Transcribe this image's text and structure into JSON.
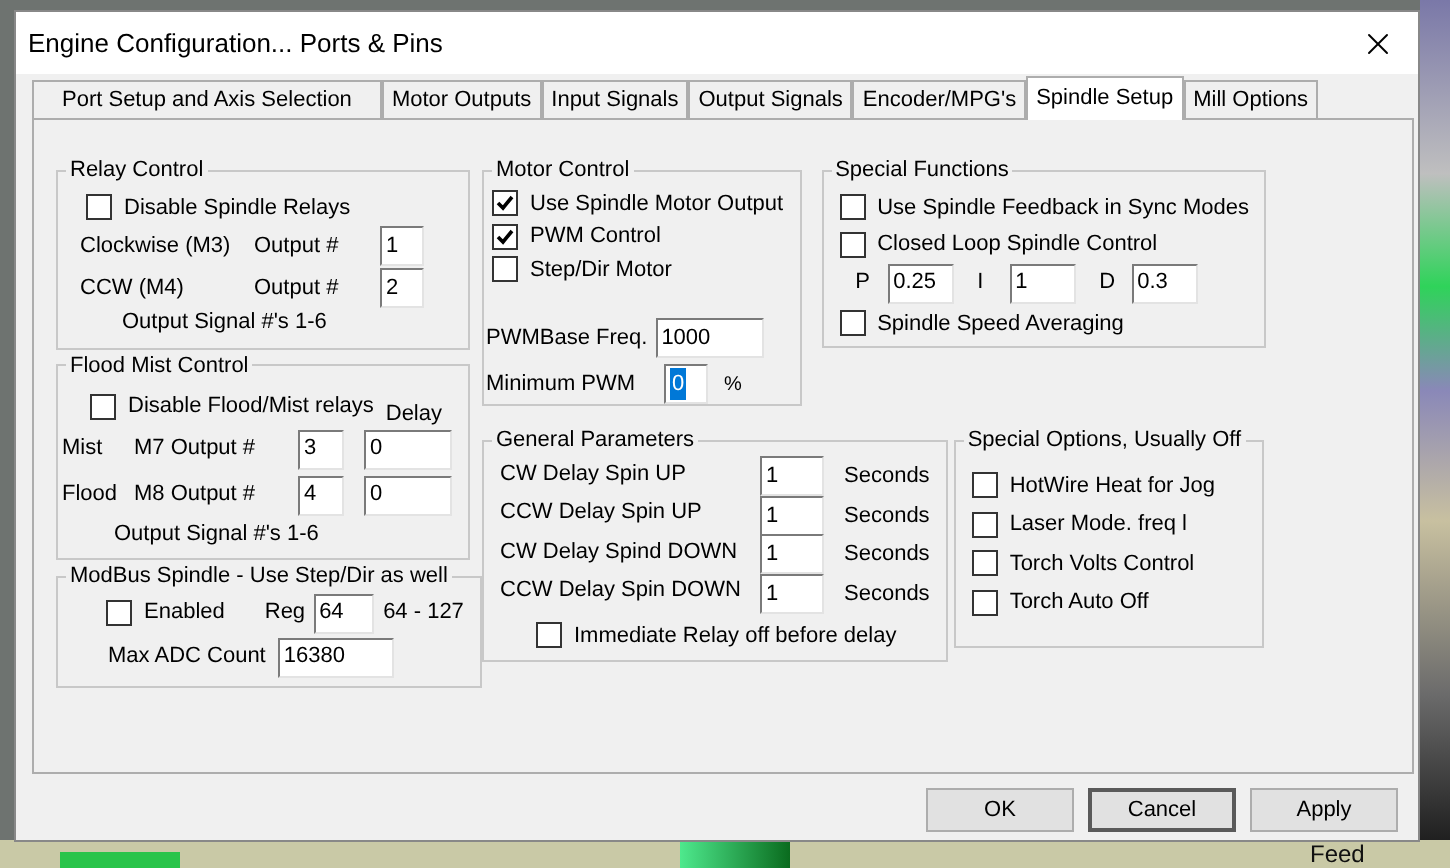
{
  "window": {
    "title": "Engine Configuration... Ports & Pins"
  },
  "tabs": [
    {
      "label": "Port Setup and Axis Selection",
      "selected": false
    },
    {
      "label": "Motor Outputs",
      "selected": false
    },
    {
      "label": "Input Signals",
      "selected": false
    },
    {
      "label": "Output Signals",
      "selected": false
    },
    {
      "label": "Encoder/MPG's",
      "selected": false
    },
    {
      "label": "Spindle Setup",
      "selected": true
    },
    {
      "label": "Mill Options",
      "selected": false
    }
  ],
  "relay_control": {
    "title": "Relay Control",
    "checkbox": {
      "label": "Disable Spindle Relays",
      "checked": false
    },
    "rows": [
      {
        "label": "Clockwise (M3)",
        "output_label": "Output #",
        "value": "1"
      },
      {
        "label": "CCW (M4)",
        "output_label": "Output #",
        "value": "2"
      }
    ],
    "note": "Output Signal #'s 1-6"
  },
  "flood_mist_control": {
    "title": "Flood Mist Control",
    "checkbox": {
      "label": "Disable Flood/Mist relays",
      "checked": false
    },
    "delay_label": "Delay",
    "rows": [
      {
        "label": "Mist",
        "output_label": "M7 Output #",
        "value": "3",
        "delay": "0"
      },
      {
        "label": "Flood",
        "output_label": "M8 Output #",
        "value": "4",
        "delay": "0"
      }
    ],
    "note": "Output Signal #'s 1-6"
  },
  "modbus_spindle": {
    "title": "ModBus Spindle - Use Step/Dir as well",
    "checkbox": {
      "label": "Enabled",
      "checked": false
    },
    "reg_label": "Reg",
    "reg_value": "64",
    "reg_range": "64 - 127",
    "max_adc_label": "Max ADC Count",
    "max_adc_value": "16380"
  },
  "motor_control": {
    "title": "Motor Control",
    "checkboxes": [
      {
        "label": "Use Spindle Motor Output",
        "checked": true
      },
      {
        "label": "PWM Control",
        "checked": true
      },
      {
        "label": "Step/Dir Motor",
        "checked": false
      }
    ],
    "pwm_base_label": "PWMBase Freq.",
    "pwm_base_value": "1000",
    "min_pwm_label": "Minimum PWM",
    "min_pwm_value": "0",
    "min_pwm_highlighted": true,
    "min_pwm_unit": "%"
  },
  "special_functions": {
    "title": "Special Functions",
    "checkboxes": [
      {
        "label": "Use Spindle Feedback in Sync Modes",
        "checked": false
      },
      {
        "label": "Closed Loop Spindle Control",
        "checked": false
      }
    ],
    "pid": [
      {
        "label": "P",
        "value": "0.25"
      },
      {
        "label": "I",
        "value": "1"
      },
      {
        "label": "D",
        "value": "0.3"
      }
    ],
    "last_checkbox": {
      "label": "Spindle Speed Averaging",
      "checked": false
    }
  },
  "general_parameters": {
    "title": "General Parameters",
    "rows": [
      {
        "label": "CW Delay Spin UP",
        "value": "1",
        "unit": "Seconds"
      },
      {
        "label": "CCW Delay Spin UP",
        "value": "1",
        "unit": "Seconds"
      },
      {
        "label": "CW Delay Spind DOWN",
        "value": "1",
        "unit": "Seconds"
      },
      {
        "label": "CCW Delay Spin DOWN",
        "value": "1",
        "unit": "Seconds"
      }
    ],
    "checkbox": {
      "label": "Immediate Relay off before delay",
      "checked": false
    }
  },
  "special_options": {
    "title": "Special Options, Usually Off",
    "checkboxes": [
      {
        "label": "HotWire Heat for Jog",
        "checked": false
      },
      {
        "label": "Laser Mode. freq l",
        "checked": false
      },
      {
        "label": "Torch Volts Control",
        "checked": false
      },
      {
        "label": "Torch Auto Off",
        "checked": false
      }
    ]
  },
  "buttons": [
    {
      "label": "OK",
      "focused": false
    },
    {
      "label": "Cancel",
      "focused": true
    },
    {
      "label": "Apply",
      "focused": false
    }
  ],
  "background_app": {
    "text": "Feed"
  }
}
